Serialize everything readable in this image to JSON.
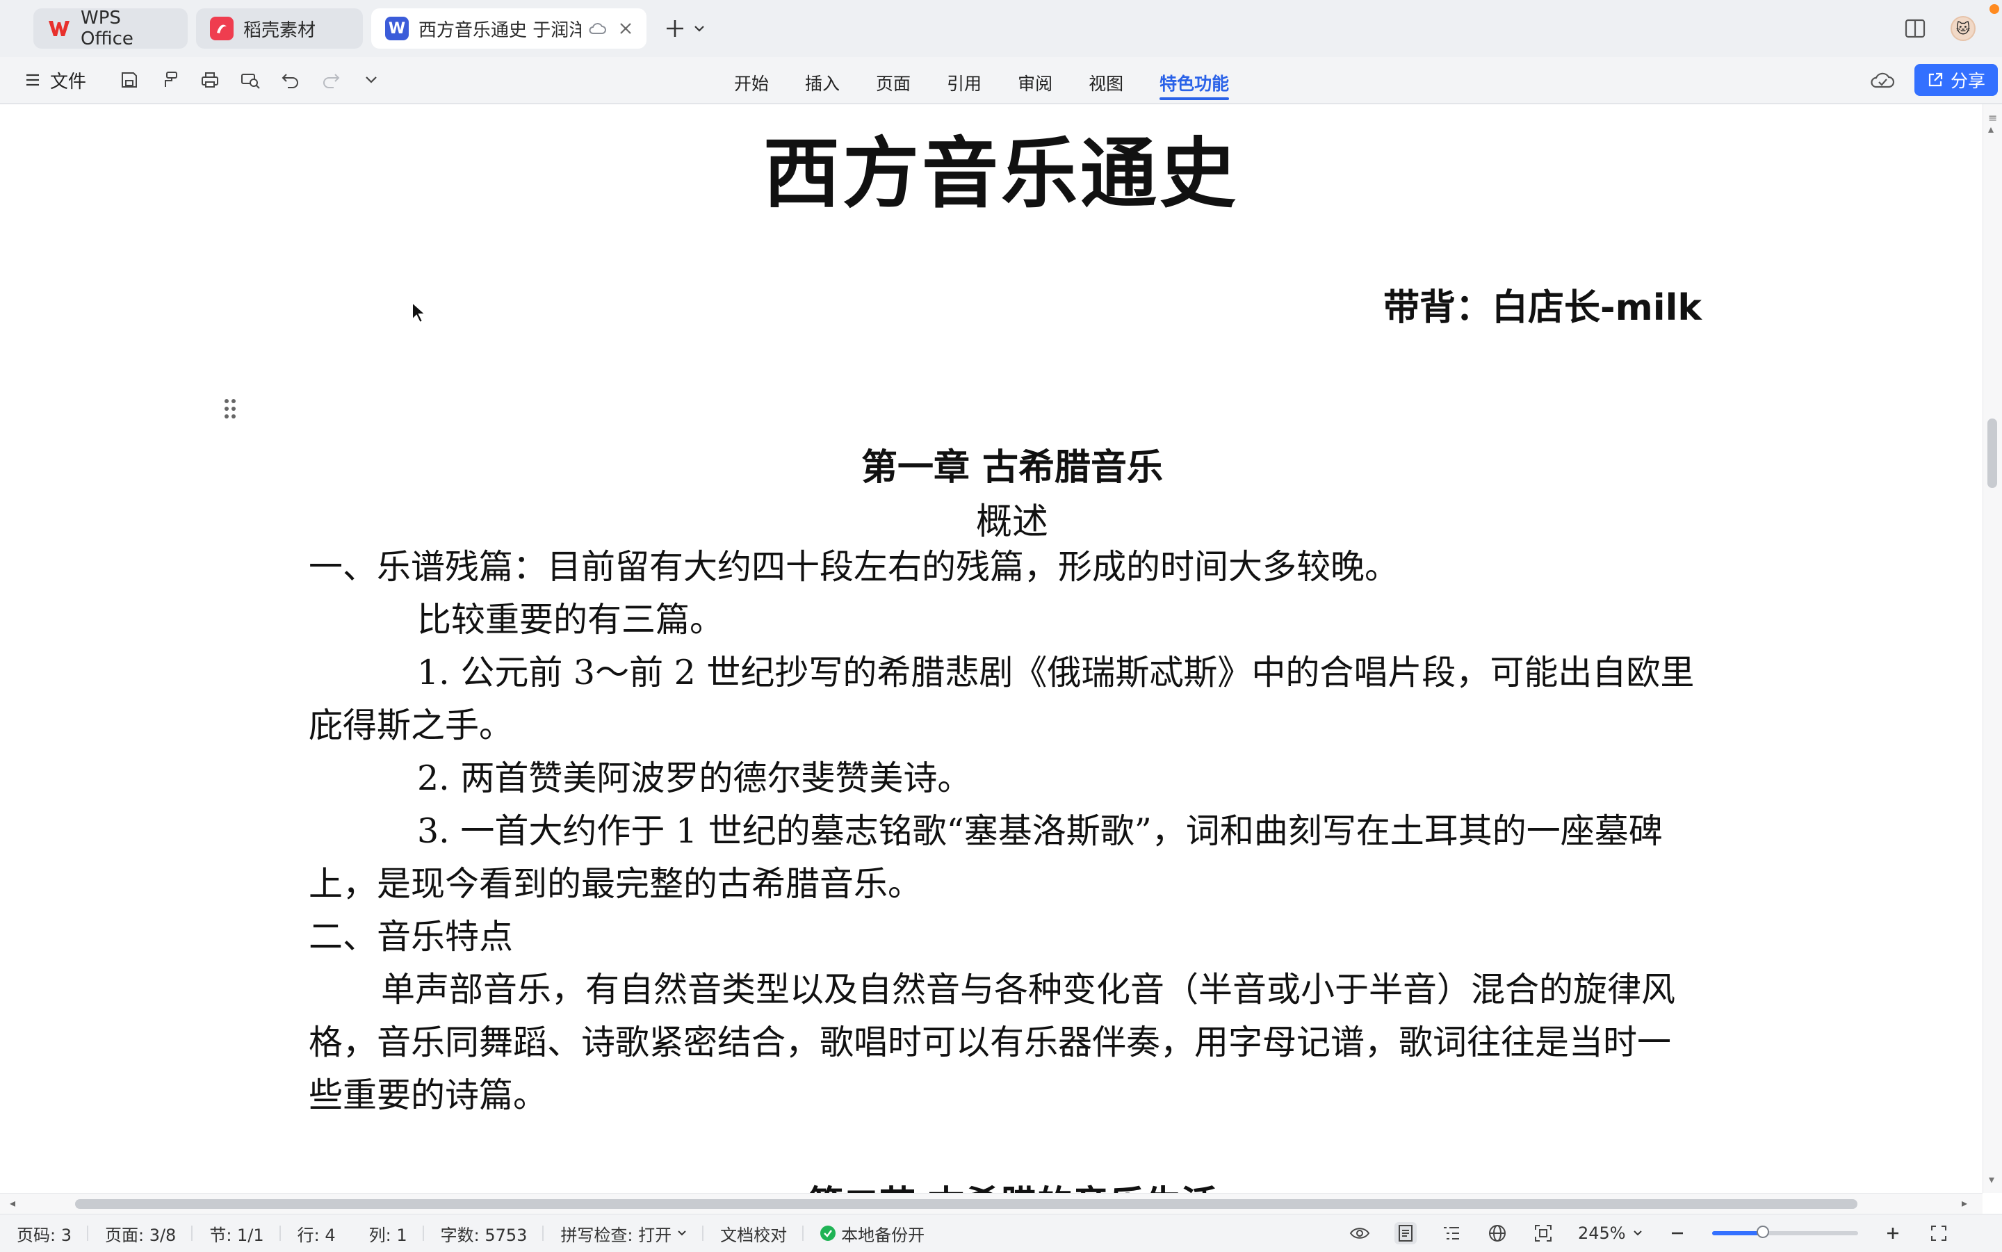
{
  "tabs": {
    "wps": {
      "label": "WPS Office",
      "icon": "wps-logo-icon",
      "color": "#e8302c"
    },
    "docer": {
      "label": "稻壳素材",
      "icon": "docer-icon",
      "color": "#ef3d4f"
    },
    "doc": {
      "label": "西方音乐通史 于润洋",
      "icon": "wps-writer-icon",
      "color": "#3b5cd9"
    }
  },
  "toolbar": {
    "file_label": "文件",
    "menu_tabs": [
      "开始",
      "插入",
      "页面",
      "引用",
      "审阅",
      "视图",
      "特色功能"
    ],
    "active_tab": "特色功能",
    "share_label": "分享",
    "accent": "#3370ff"
  },
  "document": {
    "title": "西方音乐通史",
    "author_line": "带背：白店长-milk",
    "chapter_title": "第一章  古希腊音乐",
    "overview": "概述",
    "paragraphs": [
      "一、乐谱残篇：目前留有大约四十段左右的残篇，形成的时间大多较晚。",
      "比较重要的有三篇。",
      "1. 公元前 3～前 2 世纪抄写的希腊悲剧《俄瑞斯忒斯》中的合唱片段，可能出自欧里",
      "庇得斯之手。",
      "2. 两首赞美阿波罗的德尔斐赞美诗。",
      "3. 一首大约作于 1 世纪的墓志铭歌“塞基洛斯歌”，词和曲刻写在土耳其的一座墓碑",
      "上，是现今看到的最完整的古希腊音乐。",
      "二、音乐特点",
      "单声部音乐，有自然音类型以及自然音与各种变化音（半音或小于半音）混合的旋律风",
      "格，音乐同舞蹈、诗歌紧密结合，歌唱时可以有乐器伴奏，用字母记谱，歌词往往是当时一",
      "些重要的诗篇。"
    ],
    "next_chapter_partial": "第二节  古希腊的音乐生活"
  },
  "status": {
    "page_code": "页码: 3",
    "page": "页面: 3/8",
    "section": "节: 1/1",
    "row": "行: 4",
    "col": "列: 1",
    "word_count": "字数: 5753",
    "spell_check": "拼写检查: 打开",
    "proofread": "文档校对",
    "backup": "本地备份开",
    "zoom": "245%",
    "zoom_fraction": 0.35,
    "backup_color": "#1fb355"
  }
}
